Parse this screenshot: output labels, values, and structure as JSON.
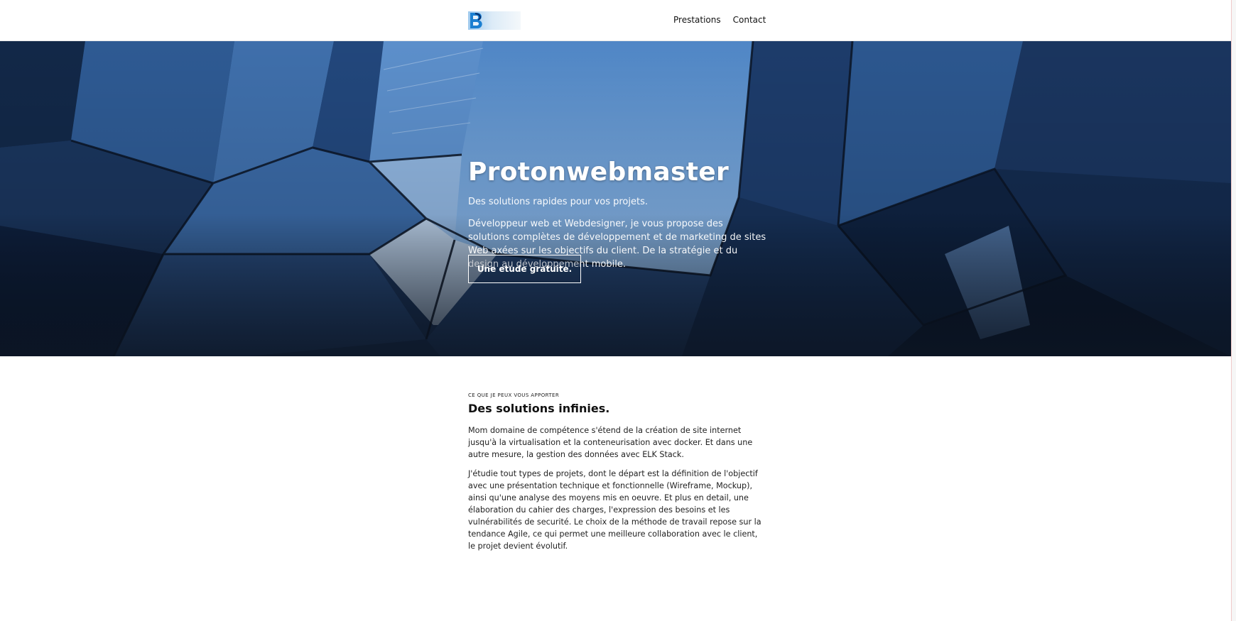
{
  "nav": {
    "logo_icon": "b-letter-logo-icon",
    "links": [
      {
        "label": "Prestations"
      },
      {
        "label": "Contact"
      }
    ]
  },
  "hero": {
    "title": "Protonwebmaster",
    "subtitle": "Des solutions rapides pour vos projets.",
    "description": "Développeur web et Webdesigner, je vous propose des solutions complètes de développement et de marketing de sites Web axées sur les objectifs du client. De la stratégie et du design au développement mobile.",
    "cta_label": "Une etude gratuite."
  },
  "about": {
    "eyebrow": "CE QUE JE PEUX VOUS APPORTER",
    "title": "Des solutions infinies.",
    "paragraphs": [
      "Mom domaine de compétence s'étend de la création de site internet jusqu'à la virtualisation et la conteneurisation avec docker. Et dans une autre mesure, la gestion des données avec ELK Stack.",
      "J'étudie tout types de projets, dont le départ est la définition de l'objectif avec une présentation technique et fonctionnelle (Wireframe, Mockup), ainsi qu'une analyse des moyens mis en oeuvre. Et plus en detail, une élaboration du cahier des charges, l'expression des besoins et les vulnérabilités de securité. Le choix de la méthode de travail repose sur la tendance Agile, ce qui permet une meilleure collaboration avec le client, le projet devient évolutif."
    ]
  },
  "colors": {
    "hero_sky": "#6d9fd6",
    "hero_dark": "#0d1a2e",
    "text": "#222222"
  }
}
